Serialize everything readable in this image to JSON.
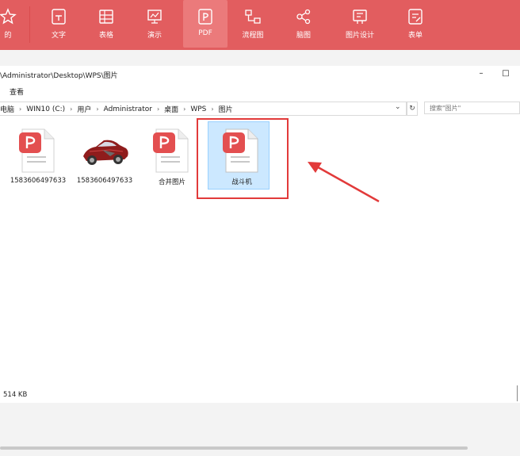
{
  "toolbar": {
    "items": [
      {
        "label": "的",
        "icon": "star-icon",
        "active": false
      },
      {
        "label": "文字",
        "icon": "text-doc-icon",
        "active": false
      },
      {
        "label": "表格",
        "icon": "table-icon",
        "active": false
      },
      {
        "label": "演示",
        "icon": "presentation-icon",
        "active": false
      },
      {
        "label": "PDF",
        "icon": "pdf-icon",
        "active": true
      },
      {
        "label": "流程图",
        "icon": "flowchart-icon",
        "active": false
      },
      {
        "label": "脑图",
        "icon": "mindmap-icon",
        "active": false
      },
      {
        "label": "图片设计",
        "icon": "image-design-icon",
        "active": false
      },
      {
        "label": "表单",
        "icon": "form-icon",
        "active": false
      }
    ]
  },
  "window": {
    "title": "\\Administrator\\Desktop\\WPS\\图片",
    "minimize": "–",
    "maximize": "□"
  },
  "ribbon": {
    "tab": "查看"
  },
  "address": {
    "crumbs": [
      "电脑",
      "WIN10 (C:)",
      "用户",
      "Administrator",
      "桌面",
      "WPS",
      "图片"
    ],
    "search_placeholder": "搜索\"图片\""
  },
  "files": [
    {
      "name": "1583606497633",
      "type": "pdf",
      "selected": false
    },
    {
      "name": "1583606497633",
      "type": "image",
      "selected": false
    },
    {
      "name": "合并图片",
      "type": "pdf",
      "selected": false
    },
    {
      "name": "战斗机",
      "type": "pdf",
      "selected": true
    }
  ],
  "status": {
    "size": "514 KB"
  },
  "colors": {
    "toolbar": "#e25d5f",
    "pdf_badge": "#e34f50",
    "selection": "#cce8ff",
    "arrow": "#e23a3a"
  }
}
